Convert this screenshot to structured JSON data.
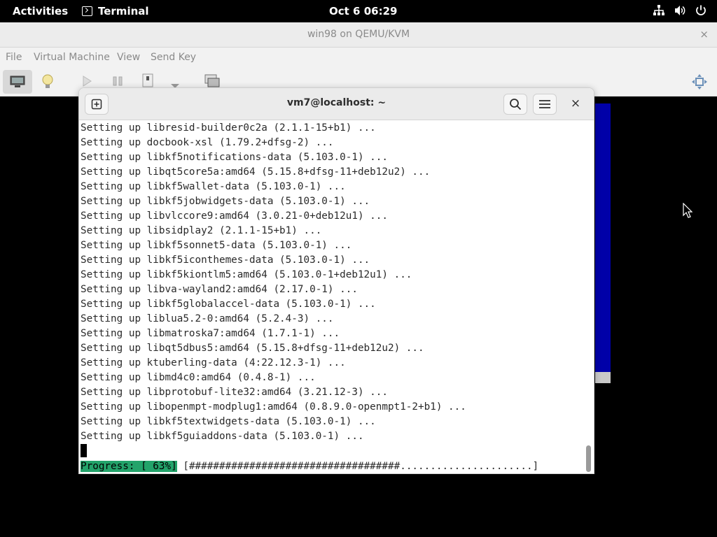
{
  "topbar": {
    "activities": "Activities",
    "app": "Terminal",
    "clock": "Oct 6  06:29",
    "tray_icons": [
      "network-icon",
      "volume-icon",
      "power-icon"
    ]
  },
  "vm_window": {
    "title": "win98 on QEMU/KVM",
    "close": "×",
    "menu": [
      "File",
      "Virtual Machine",
      "View",
      "Send Key"
    ],
    "toolbar_icons": [
      "console-icon",
      "details-lightbulb-icon",
      "run-icon",
      "pause-icon",
      "shutdown-icon",
      "dropdown-icon",
      "snapshot-icon",
      "fullscreen-icon"
    ]
  },
  "terminal": {
    "title": "vm7@localhost: ~",
    "new_tab_icon": "new-tab-icon",
    "search_icon": "search-icon",
    "menu_icon": "hamburger-menu-icon",
    "close": "×",
    "lines": [
      "Setting up libresid-builder0c2a (2.1.1-15+b1) ...",
      "Setting up docbook-xsl (1.79.2+dfsg-2) ...",
      "Setting up libkf5notifications-data (5.103.0-1) ...",
      "Setting up libqt5core5a:amd64 (5.15.8+dfsg-11+deb12u2) ...",
      "Setting up libkf5wallet-data (5.103.0-1) ...",
      "Setting up libkf5jobwidgets-data (5.103.0-1) ...",
      "Setting up libvlccore9:amd64 (3.0.21-0+deb12u1) ...",
      "Setting up libsidplay2 (2.1.1-15+b1) ...",
      "Setting up libkf5sonnet5-data (5.103.0-1) ...",
      "Setting up libkf5iconthemes-data (5.103.0-1) ...",
      "Setting up libkf5kiontlm5:amd64 (5.103.0-1+deb12u1) ...",
      "Setting up libva-wayland2:amd64 (2.17.0-1) ...",
      "Setting up libkf5globalaccel-data (5.103.0-1) ...",
      "Setting up liblua5.2-0:amd64 (5.2.4-3) ...",
      "Setting up libmatroska7:amd64 (1.7.1-1) ...",
      "Setting up libqt5dbus5:amd64 (5.15.8+dfsg-11+deb12u2) ...",
      "Setting up ktuberling-data (4:22.12.3-1) ...",
      "Setting up libmd4c0:amd64 (0.4.8-1) ...",
      "Setting up libprotobuf-lite32:amd64 (3.21.12-3) ...",
      "Setting up libopenmpt-modplug1:amd64 (0.8.9.0-openmpt1-2+b1) ...",
      "Setting up libkf5textwidgets-data (5.103.0-1) ...",
      "Setting up libkf5guiaddons-data (5.103.0-1) ..."
    ],
    "progress_label": "Progress: [ 63%]",
    "progress_bar": " [###################################......................]",
    "progress_percent": 63
  }
}
